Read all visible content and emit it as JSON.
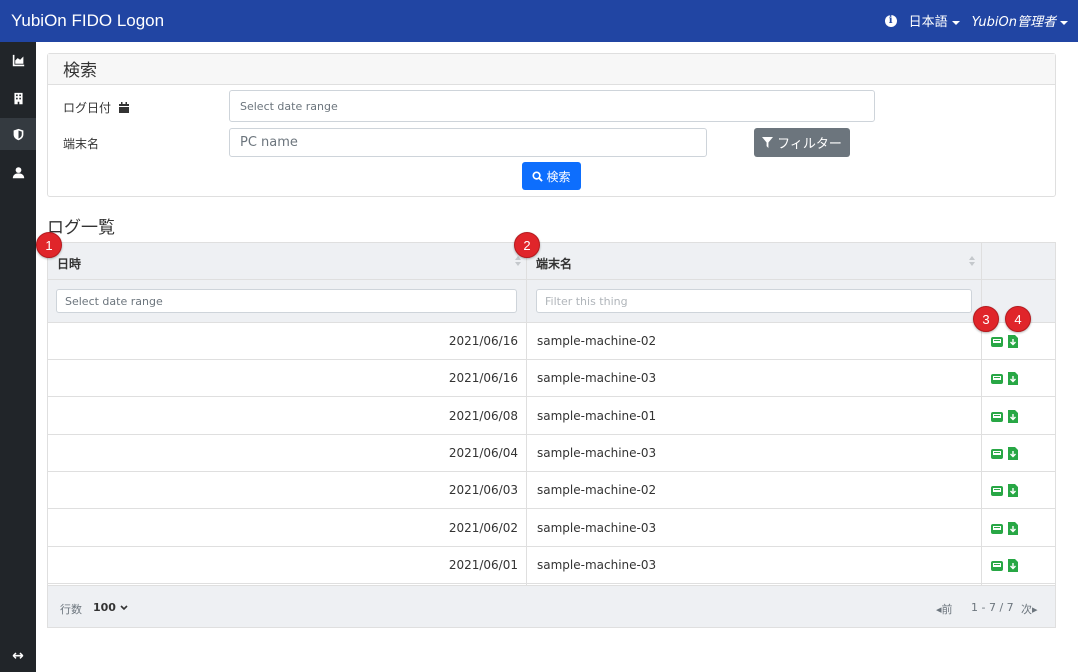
{
  "header": {
    "brand": "YubiOn FIDO Logon",
    "language": "日本語",
    "user": "YubiOn管理者"
  },
  "search": {
    "title": "検索",
    "log_date_label": "ログ日付",
    "date_placeholder": "Select date range",
    "terminal_label": "端末名",
    "pc_placeholder": "PC name",
    "filter_button": "フィルター",
    "search_button": "検索"
  },
  "log_list": {
    "title": "ログ一覧",
    "columns": {
      "datetime": "日時",
      "terminal": "端末名"
    },
    "date_filter_placeholder": "Select date range",
    "name_filter_placeholder": "Filter this thing",
    "rows": [
      {
        "date": "2021/06/16",
        "name": "sample-machine-02"
      },
      {
        "date": "2021/06/16",
        "name": "sample-machine-03"
      },
      {
        "date": "2021/06/08",
        "name": "sample-machine-01"
      },
      {
        "date": "2021/06/04",
        "name": "sample-machine-03"
      },
      {
        "date": "2021/06/03",
        "name": "sample-machine-02"
      },
      {
        "date": "2021/06/02",
        "name": "sample-machine-03"
      },
      {
        "date": "2021/06/01",
        "name": "sample-machine-03"
      }
    ]
  },
  "footer": {
    "rows_label": "行数",
    "rows_value": "100",
    "prev": "前",
    "range": "1 - 7 / 7",
    "next": "次"
  },
  "annotations": [
    "1",
    "2",
    "3",
    "4"
  ],
  "colors": {
    "navbar": "#2145a3",
    "sidebar": "#212529",
    "action_icon": "#28a745",
    "badge": "#e0252a",
    "search_button": "#0d6efd"
  }
}
